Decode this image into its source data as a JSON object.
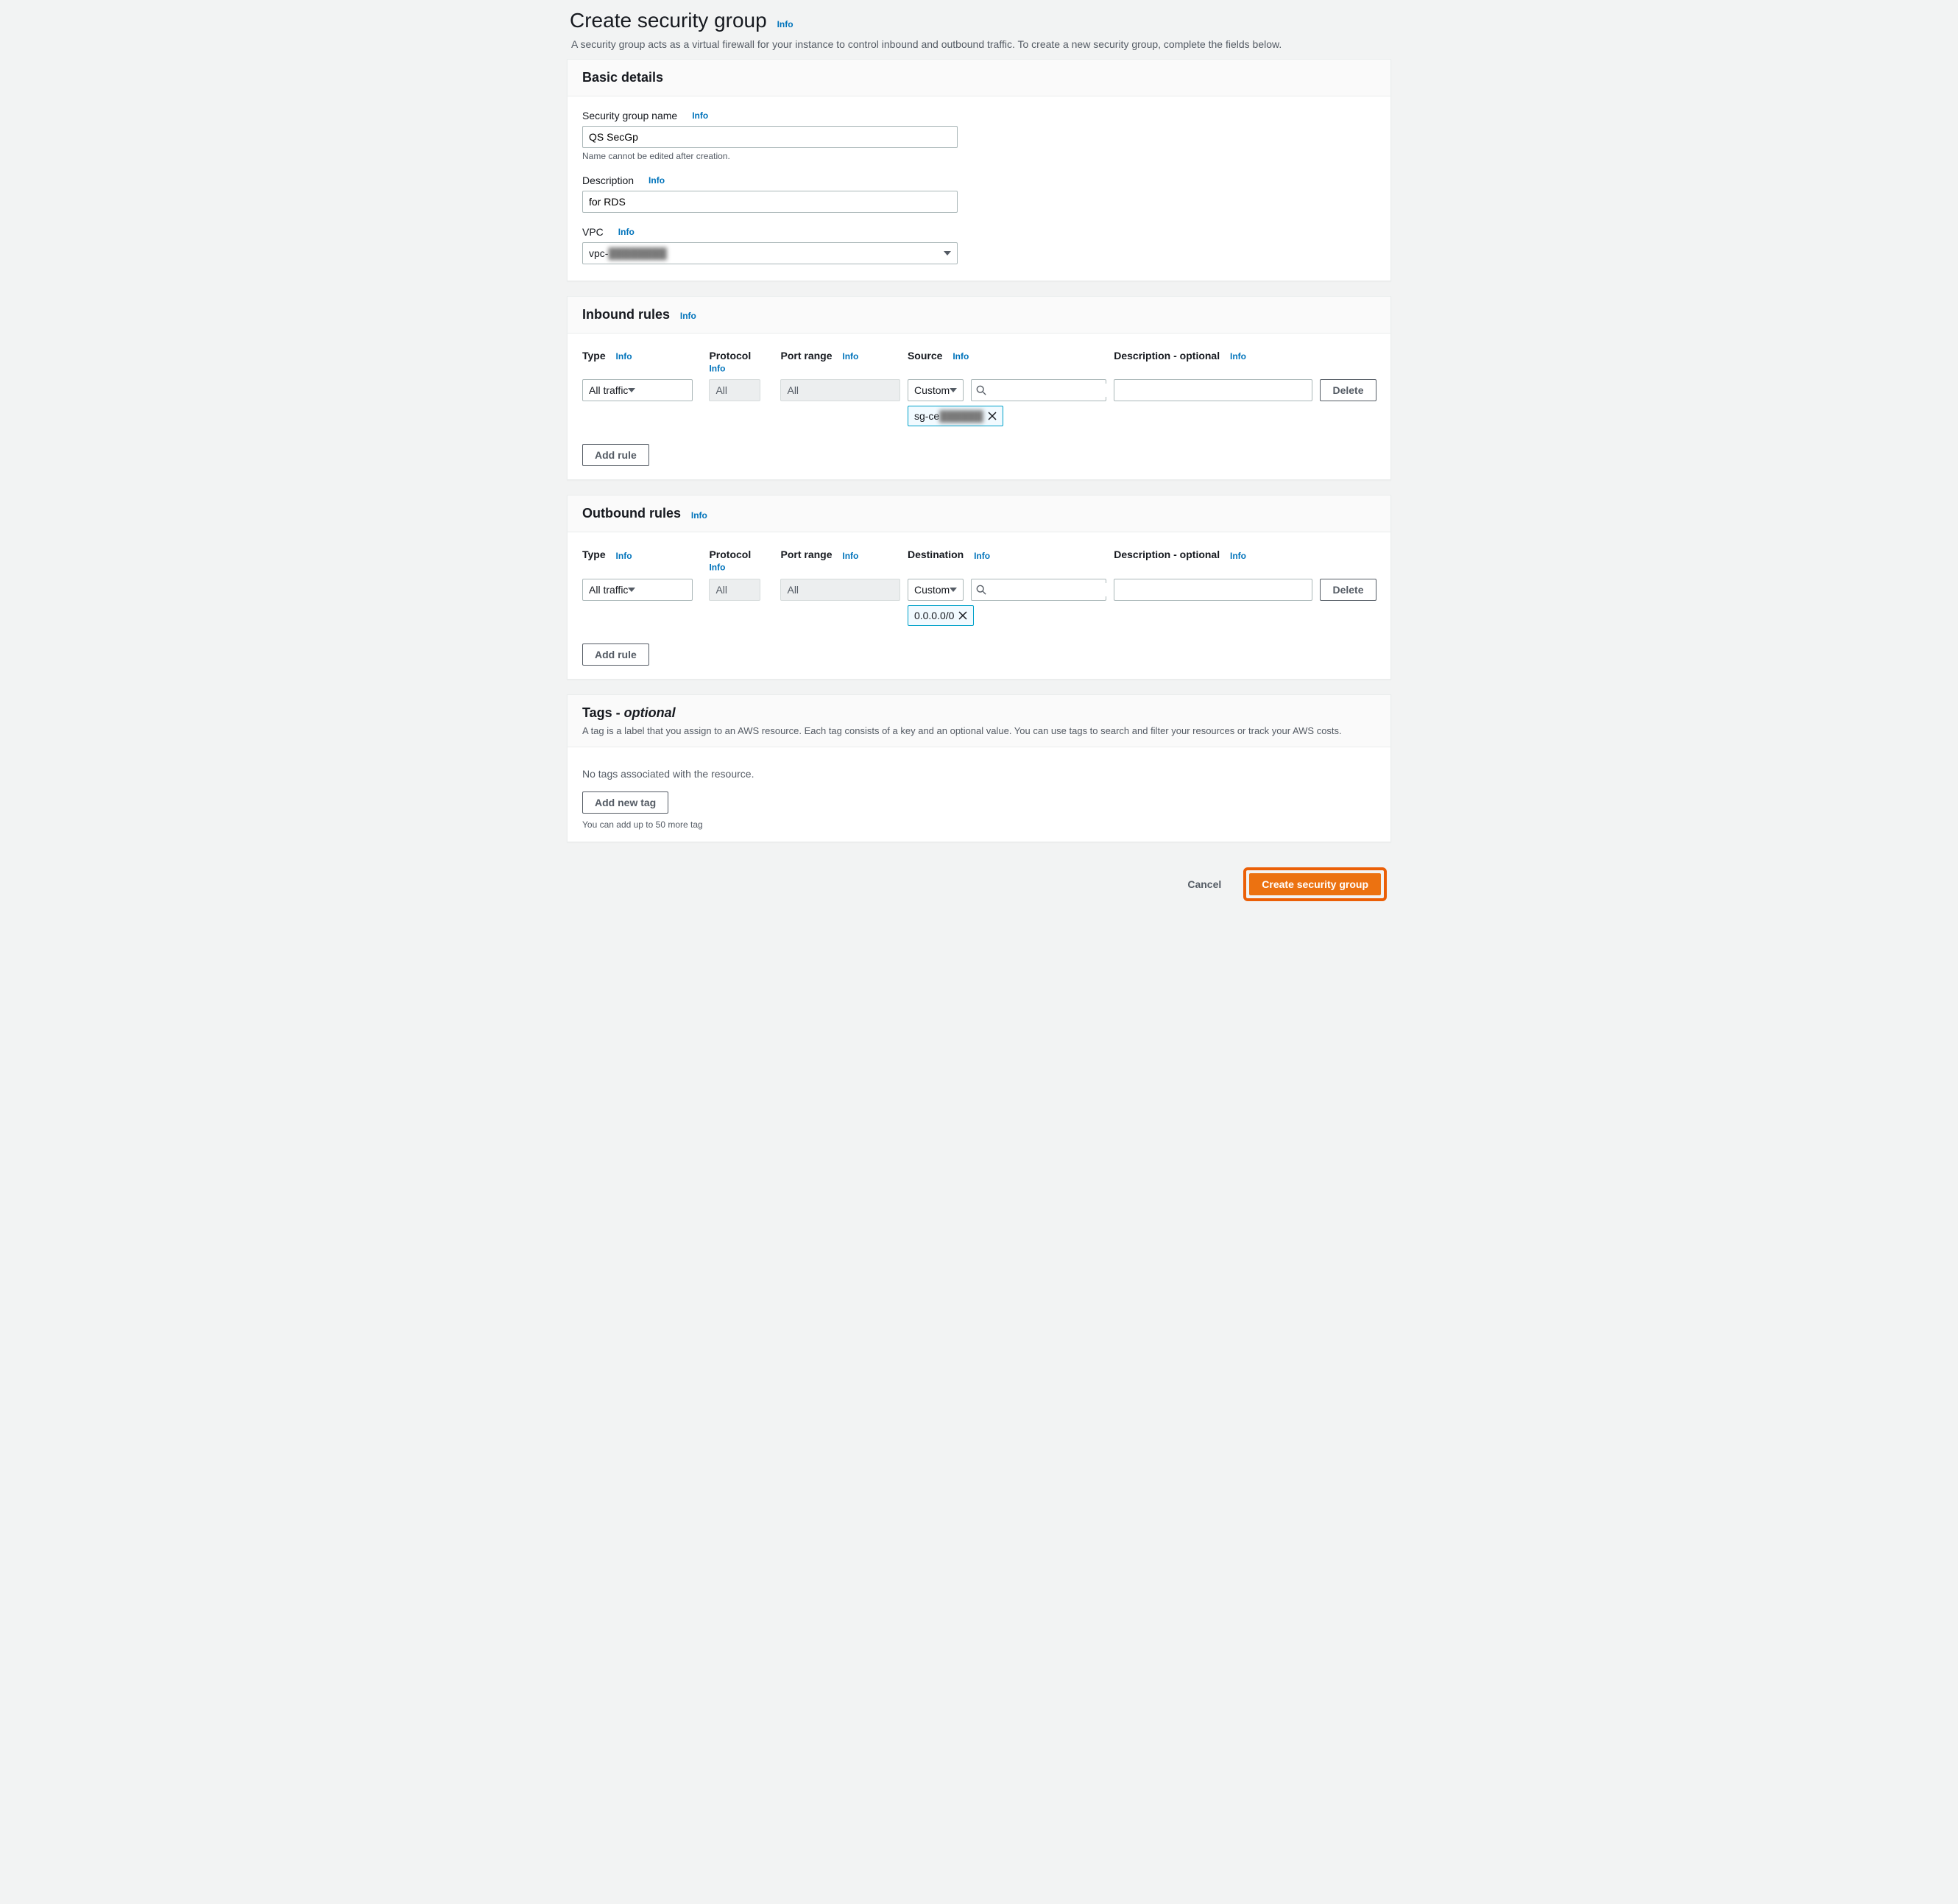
{
  "page": {
    "title": "Create security group",
    "info": "Info",
    "description": "A security group acts as a virtual firewall for your instance to control inbound and outbound traffic. To create a new security group, complete the fields below."
  },
  "basic": {
    "title": "Basic details",
    "name_label": "Security group name",
    "name_value": "QS SecGp",
    "name_hint": "Name cannot be edited after creation.",
    "desc_label": "Description",
    "desc_value": "for RDS",
    "vpc_label": "VPC",
    "vpc_prefix": "vpc-",
    "vpc_masked": "████████"
  },
  "labels": {
    "type": "Type",
    "protocol": "Protocol",
    "port": "Port range",
    "source": "Source",
    "destination": "Destination",
    "desc_opt": "Description - optional",
    "add_rule": "Add rule",
    "delete": "Delete",
    "info": "Info"
  },
  "inbound": {
    "title": "Inbound rules",
    "rules": [
      {
        "type": "All traffic",
        "protocol": "All",
        "port": "All",
        "source_mode": "Custom",
        "source_token_prefix": "sg-ce",
        "source_token_masked": "██████",
        "description": ""
      }
    ]
  },
  "outbound": {
    "title": "Outbound rules",
    "rules": [
      {
        "type": "All traffic",
        "protocol": "All",
        "port": "All",
        "dest_mode": "Custom",
        "dest_token": "0.0.0.0/0",
        "description": ""
      }
    ]
  },
  "tags": {
    "title": "Tags - ",
    "optional": "optional",
    "desc": "A tag is a label that you assign to an AWS resource. Each tag consists of a key and an optional value. You can use tags to search and filter your resources or track your AWS costs.",
    "empty": "No tags associated with the resource.",
    "add": "Add new tag",
    "limit": "You can add up to 50 more tag"
  },
  "footer": {
    "cancel": "Cancel",
    "create": "Create security group"
  }
}
